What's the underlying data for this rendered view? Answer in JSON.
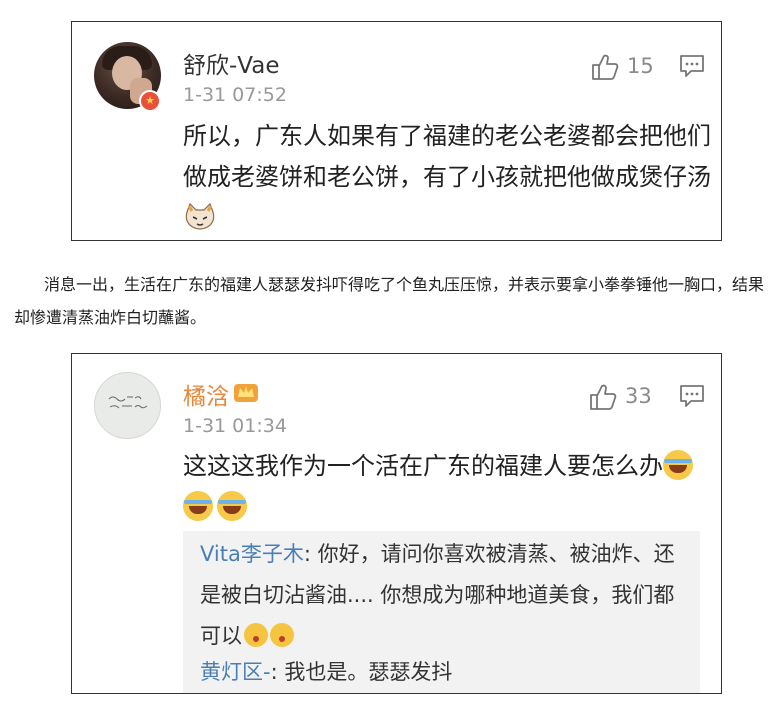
{
  "card1": {
    "username": "舒欣-Vae",
    "timestamp": "1-31 07:52",
    "like_count": "15",
    "comment": "所以，广东人如果有了福建的老公老婆都会把他们做成老婆饼和老公饼，有了小孩就把他做成煲仔汤"
  },
  "paragraph": "消息一出，生活在广东的福建人瑟瑟发抖吓得吃了个鱼丸压压惊，并表示要拿小拳拳锤他一胸口，结果却惨遭清蒸油炸白切蘸酱。",
  "card2": {
    "username": "橘浛",
    "timestamp": "1-31 01:34",
    "like_count": "33",
    "comment": "这这这我作为一个活在广东的福建人要怎么办",
    "replies": [
      {
        "author": "Vita李子木",
        "text": ": 你好，请问你喜欢被清蒸、被油炸、还是被白切沾酱油.... 你想成为哪种地道美食，我们都可以"
      },
      {
        "author": "黄灯区-",
        "text": ": 我也是。瑟瑟发抖"
      }
    ]
  },
  "icons": {
    "like": "thumbs-up-icon",
    "reply": "comment-bubble-icon",
    "verified": "verified-badge-icon",
    "vip": "crown-icon"
  },
  "colors": {
    "vip_username": "#e6883c",
    "reply_author": "#4a7fb5",
    "timestamp": "#999999"
  }
}
